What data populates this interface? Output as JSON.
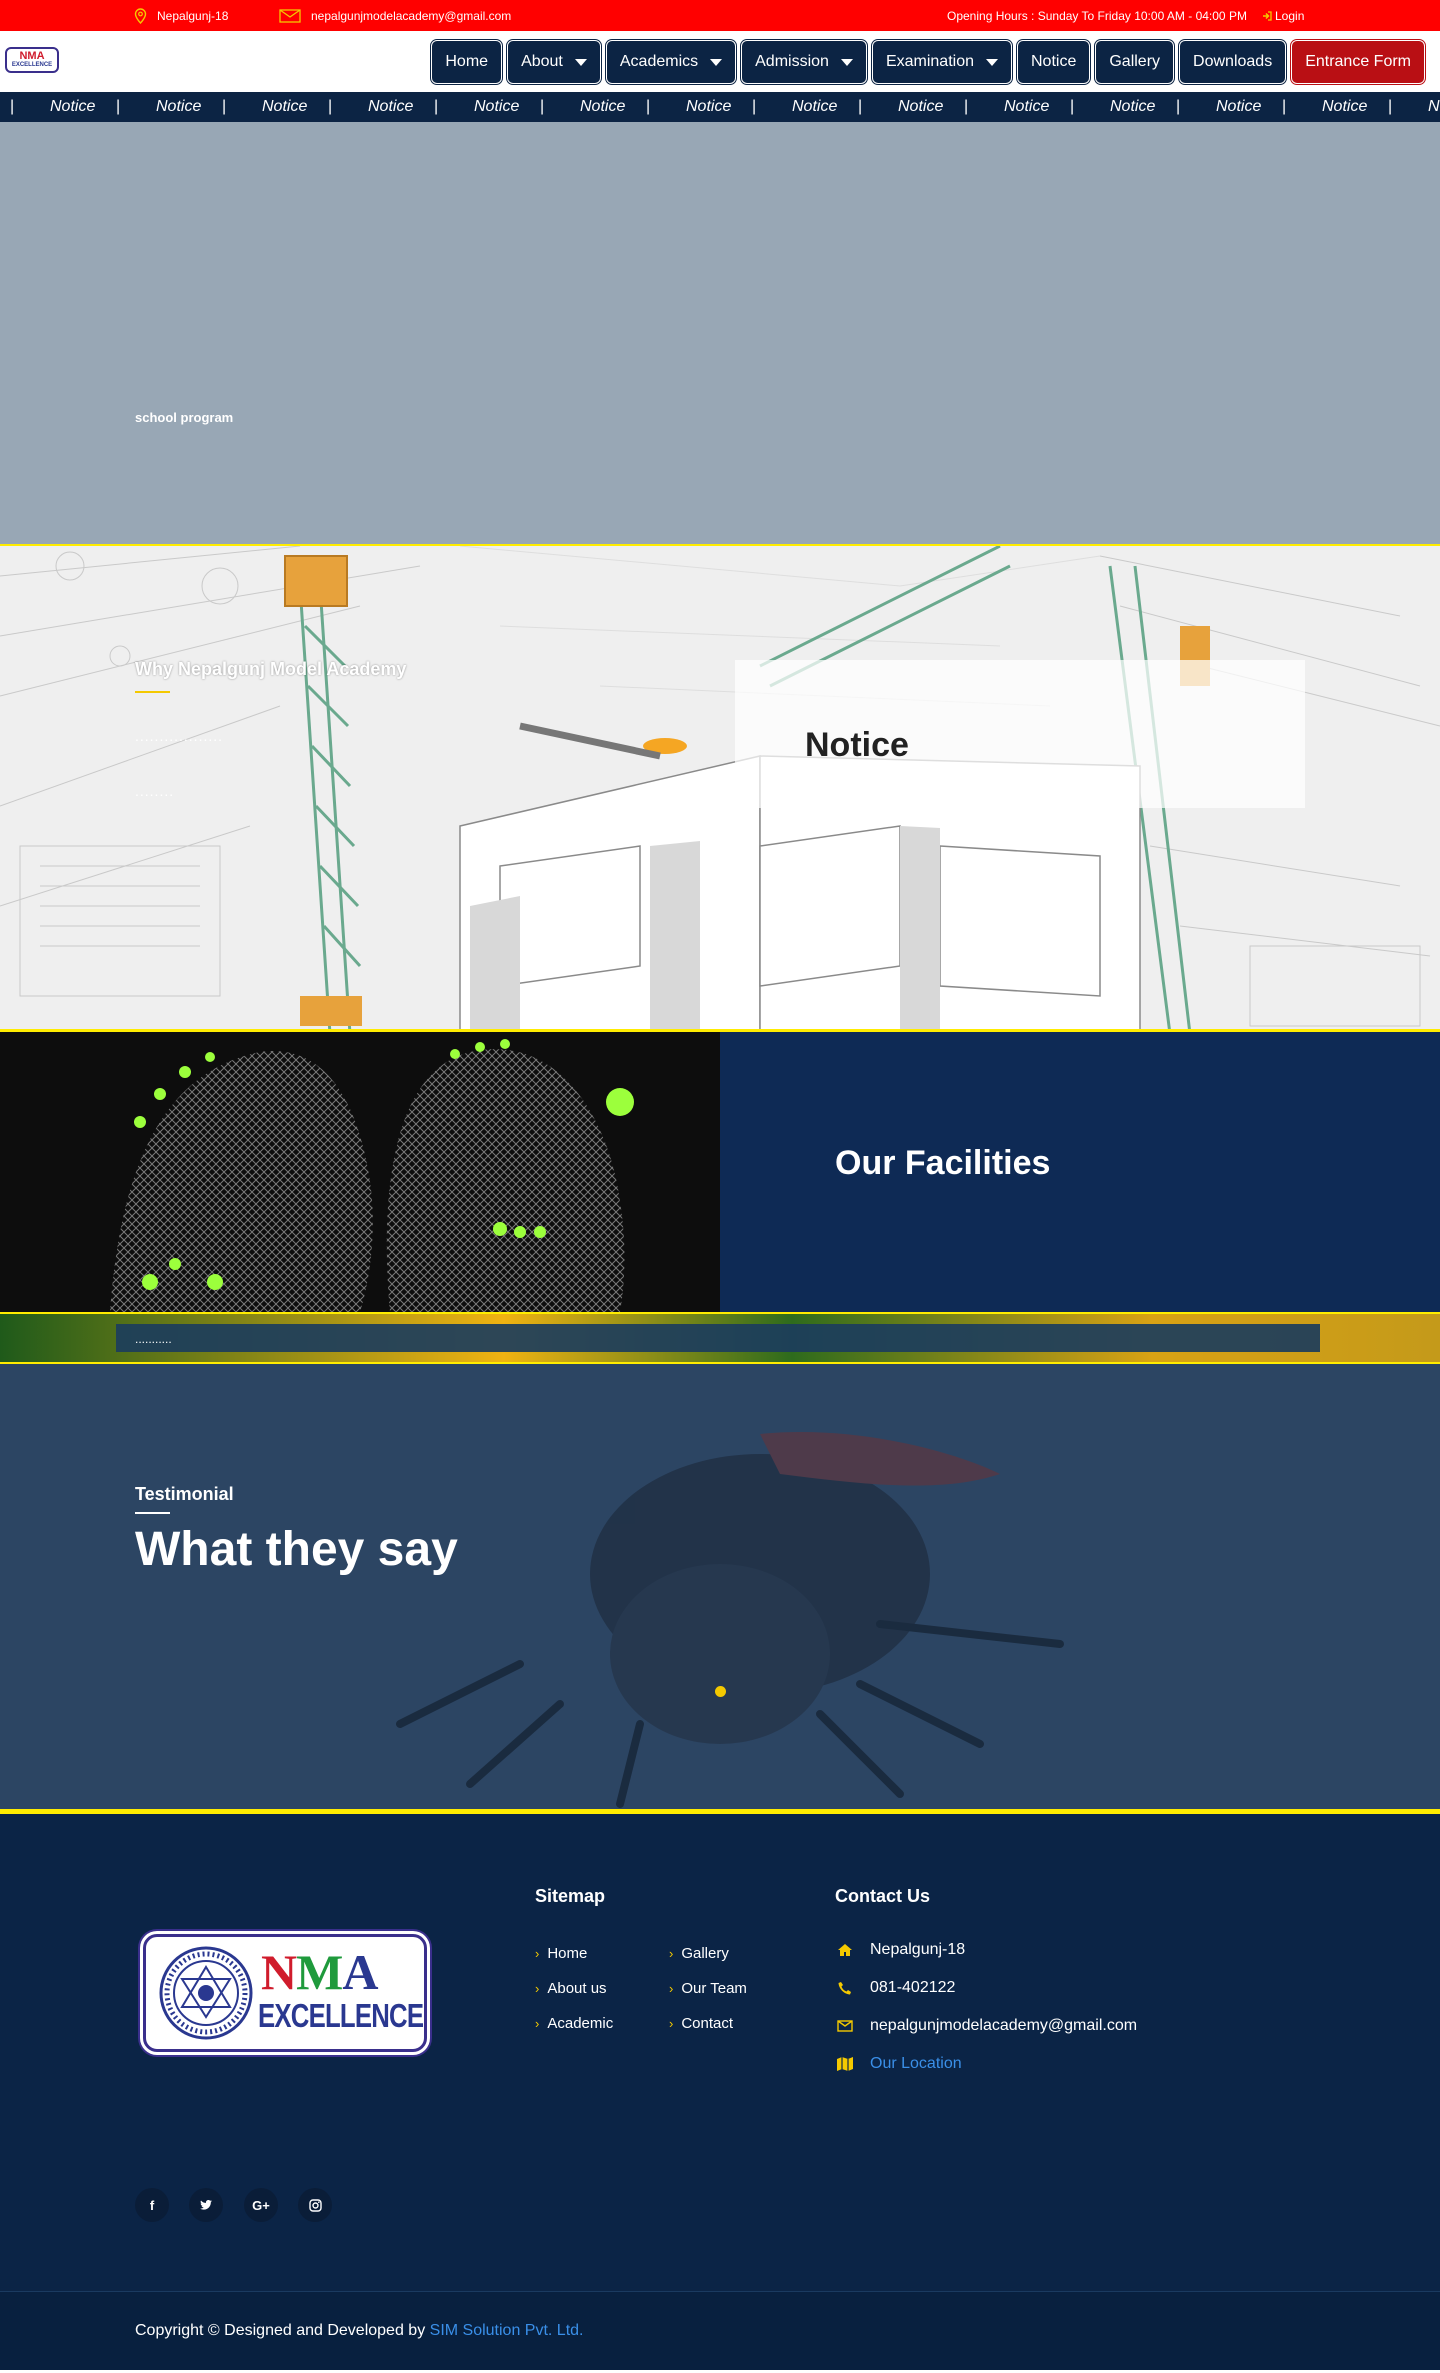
{
  "topbar": {
    "location": "Nepalgunj-18",
    "email": "nepalgunjmodelacademy@gmail.com",
    "hours": "Opening Hours : Sunday To Friday 10:00 AM - 04:00 PM",
    "login": "Login"
  },
  "header": {
    "logo": {
      "line1": "NMA",
      "line2": "EXCELLENCE"
    },
    "nav": [
      {
        "label": "Home"
      },
      {
        "label": "About"
      },
      {
        "label": "Academics"
      },
      {
        "label": "Admission"
      },
      {
        "label": "Examination"
      },
      {
        "label": "Notice"
      },
      {
        "label": "Gallery"
      },
      {
        "label": "Downloads"
      },
      {
        "label": "Entrance Form"
      }
    ]
  },
  "marquee": {
    "separator": "|",
    "items": [
      "Notice",
      "Notice",
      "Notice",
      "Notice",
      "Notice",
      "Notice",
      "Notice",
      "Notice",
      "Notice",
      "Notice",
      "Notice",
      "Notice",
      "Notice",
      "N"
    ]
  },
  "hero": {
    "caption": "school program"
  },
  "why_section": {
    "title": "Why Nepalgunj Model Academy",
    "dots1": "..................",
    "dots2": "........"
  },
  "notice_box": {
    "title": "Notice"
  },
  "facilities": {
    "title": "Our Facilities"
  },
  "strip": {
    "dots": "..........."
  },
  "testimonial": {
    "label": "Testimonial",
    "heading": "What they say"
  },
  "footer": {
    "logo": {
      "nma": "NMA",
      "excellence": "EXCELLENCE"
    },
    "sitemap": {
      "title": "Sitemap",
      "links": [
        "Home",
        "Gallery",
        "About us",
        "Our Team",
        "Academic",
        "Contact"
      ]
    },
    "contact": {
      "title": "Contact Us",
      "address": "Nepalgunj-18",
      "phone": "081-402122",
      "email": "nepalgunjmodelacademy@gmail.com",
      "location": "Our Location"
    },
    "social": {
      "facebook": "f",
      "twitter": "t",
      "googleplus": "G+",
      "instagram": "ig"
    }
  },
  "copyright": {
    "text": "Copyright © Designed and Developed by ",
    "company": "SIM Solution Pvt. Ltd."
  },
  "colors": {
    "topbar": "#ff0000",
    "nav_bg": "#0c2444",
    "nav_highlight": "#b90f14",
    "accent_yellow": "#ffec00",
    "footer_bg": "#0b2446",
    "link_blue": "#3a8fe8"
  }
}
